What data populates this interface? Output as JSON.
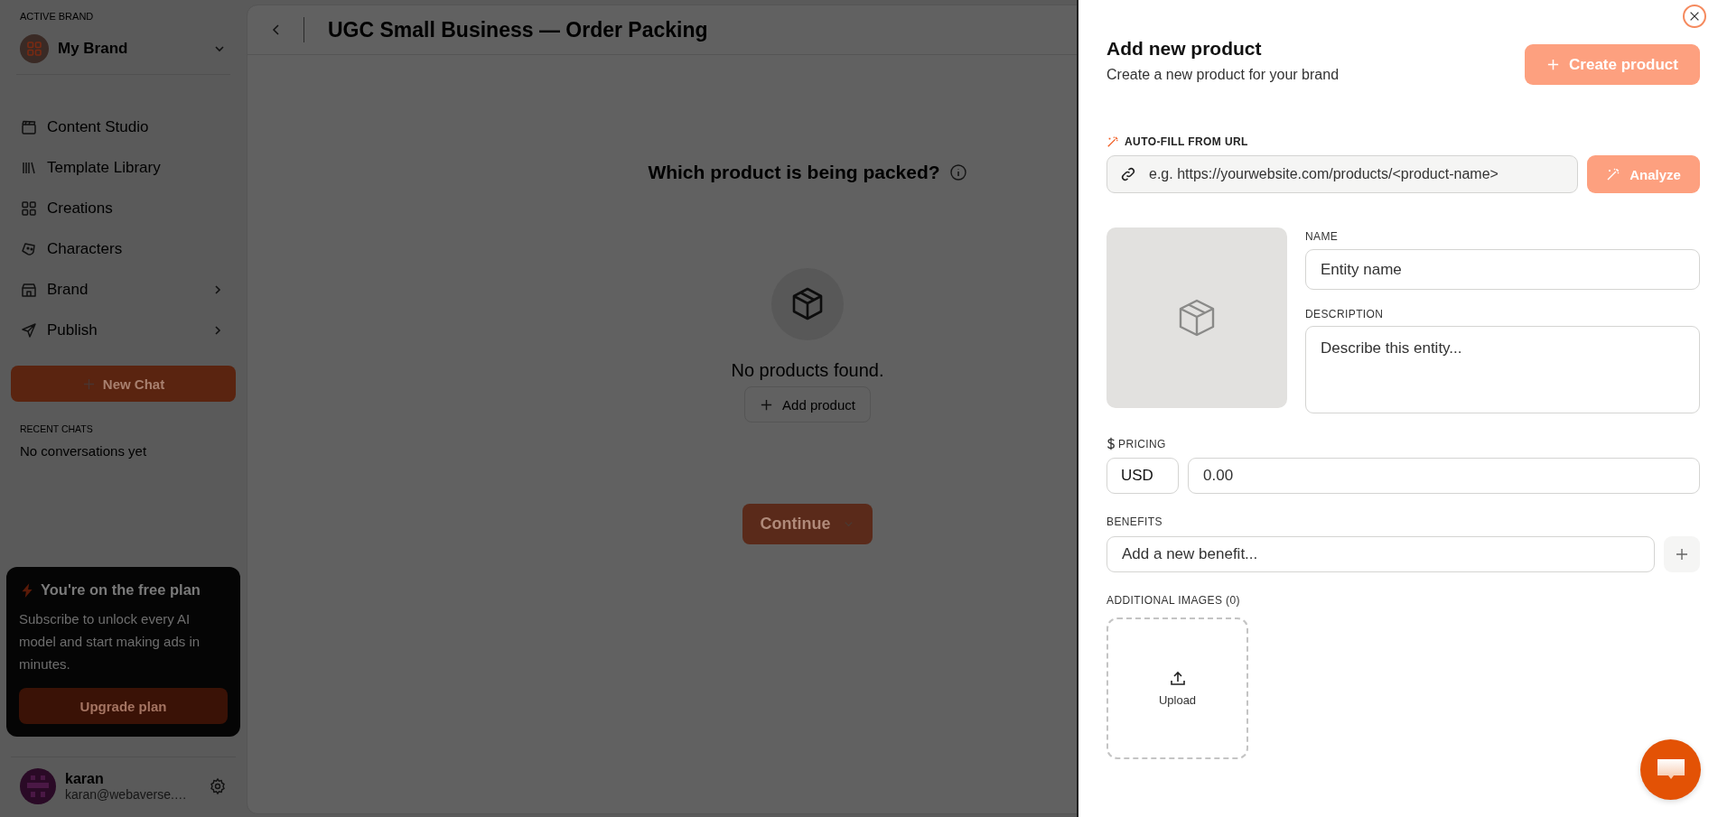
{
  "sidebar": {
    "active_brand_label": "ACTIVE BRAND",
    "brand": {
      "name": "My Brand"
    },
    "nav": [
      {
        "label": "Content Studio",
        "has_submenu": false
      },
      {
        "label": "Template Library",
        "has_submenu": false
      },
      {
        "label": "Creations",
        "has_submenu": false
      },
      {
        "label": "Characters",
        "has_submenu": false
      },
      {
        "label": "Brand",
        "has_submenu": true
      },
      {
        "label": "Publish",
        "has_submenu": true
      }
    ],
    "new_chat_button": "New Chat",
    "recent_chats_label": "RECENT CHATS",
    "recent_chats_empty": "No conversations yet",
    "plan_card": {
      "title": "You're on the free plan",
      "text": "Subscribe to unlock every AI model and start making ads in minutes.",
      "button": "Upgrade plan"
    },
    "user": {
      "name": "karan",
      "email": "karan@webaverse.…"
    }
  },
  "main": {
    "title": "UGC Small Business — Order Packing",
    "question": "Which product is being packed?",
    "empty_text": "No products found.",
    "add_button": "Add product",
    "continue_button": "Continue"
  },
  "drawer": {
    "title": "Add new product",
    "subtitle": "Create a new product for your brand",
    "create_button": "Create product",
    "autofill": {
      "label": "AUTO-FILL FROM URL",
      "placeholder": "e.g. https://yourwebsite.com/products/<product-name>",
      "button": "Analyze"
    },
    "name": {
      "label": "NAME",
      "placeholder": "Entity name"
    },
    "description": {
      "label": "DESCRIPTION",
      "placeholder": "Describe this entity..."
    },
    "pricing": {
      "label": "PRICING",
      "currency": "USD",
      "placeholder": "0.00"
    },
    "benefits": {
      "label": "BENEFITS",
      "placeholder": "Add a new benefit..."
    },
    "additional_images": {
      "label": "ADDITIONAL IMAGES (0)",
      "upload_label": "Upload"
    }
  }
}
